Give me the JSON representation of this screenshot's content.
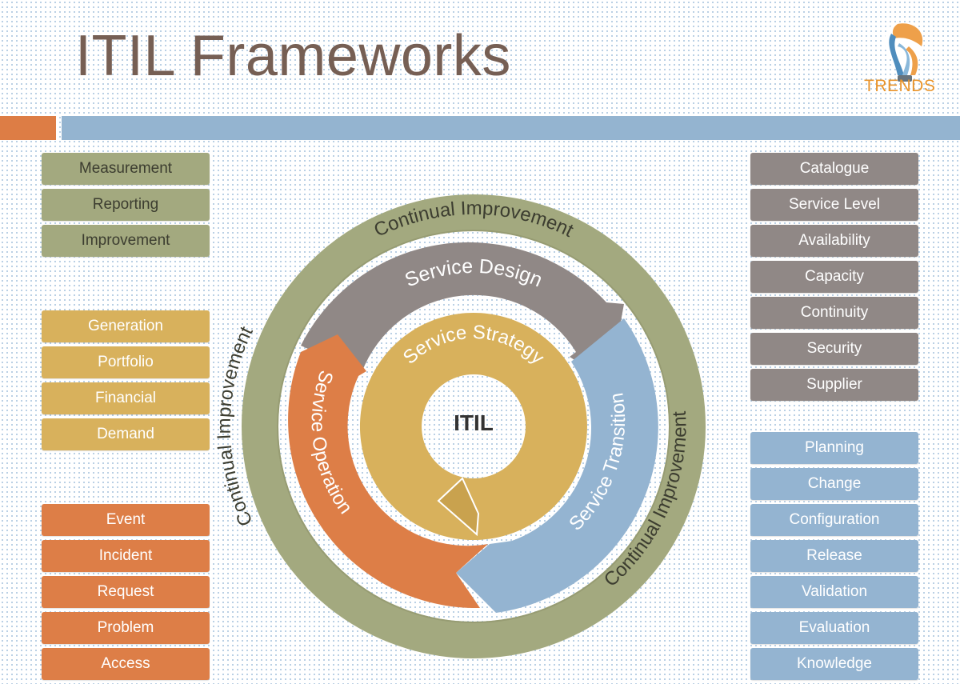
{
  "header": {
    "title": "ITIL Frameworks",
    "logo_text": "TRENDS",
    "logo_icon": "lightbulb-icon"
  },
  "colors": {
    "continual_improvement": "#a3a97f",
    "service_strategy": "#d8b15c",
    "service_operation": "#dd7e47",
    "service_design": "#908886",
    "service_transition": "#94b4d1",
    "title": "#765f54",
    "accent_orange": "#dd7d45",
    "accent_blue": "#94b4d0"
  },
  "diagram": {
    "center_label": "ITIL",
    "outer_ring_label": "Continual Improvement",
    "stages": {
      "design": "Service Design",
      "strategy": "Service Strategy",
      "transition": "Service Transition",
      "operation": "Service Operation"
    }
  },
  "lists": {
    "continual_improvement": [
      "Measurement",
      "Reporting",
      "Improvement"
    ],
    "service_strategy": [
      "Generation",
      "Portfolio",
      "Financial",
      "Demand"
    ],
    "service_operation": [
      "Event",
      "Incident",
      "Request",
      "Problem",
      "Access"
    ],
    "service_design": [
      "Catalogue",
      "Service Level",
      "Availability",
      "Capacity",
      "Continuity",
      "Security",
      "Supplier"
    ],
    "service_transition": [
      "Planning",
      "Change",
      "Configuration",
      "Release",
      "Validation",
      "Evaluation",
      "Knowledge"
    ]
  }
}
